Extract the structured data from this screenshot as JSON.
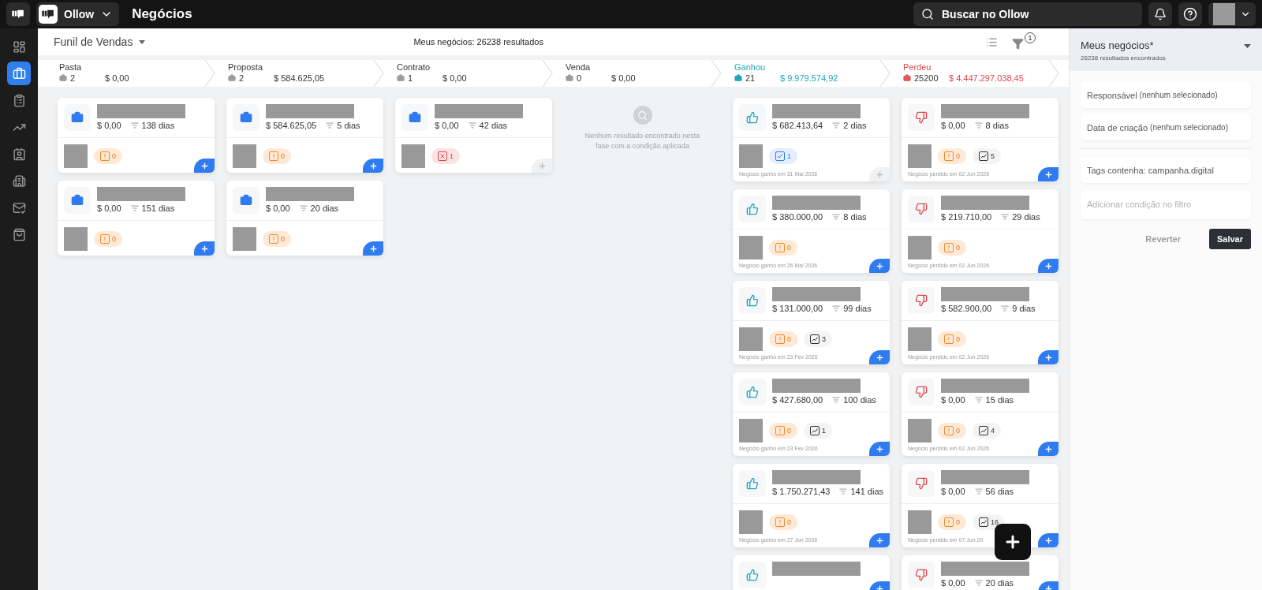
{
  "topbar": {
    "app_name": "Ollow",
    "page_title": "Negócios",
    "search": {
      "placeholder": "Buscar no Ollow"
    }
  },
  "sidebar": {
    "items": [
      {
        "selected": false
      },
      {
        "selected": true
      },
      {
        "selected": false
      },
      {
        "selected": false
      },
      {
        "selected": false
      },
      {
        "selected": false
      },
      {
        "selected": false
      },
      {
        "selected": false
      }
    ]
  },
  "toolbar": {
    "pipeline": "Funil de Vendas",
    "summary_label": "Meus negócios:",
    "summary_value": "26238 resultados",
    "filter_count": "1"
  },
  "stages": [
    {
      "name": "Pasta",
      "kind": "open",
      "count": "2",
      "total": "$ 0,00",
      "cards": [
        {
          "amount": "$ 0,00",
          "days": "138 dias",
          "badges": [
            {
              "kind": "alert",
              "count": "0"
            }
          ],
          "add_enabled": true
        },
        {
          "amount": "$ 0,00",
          "days": "151 dias",
          "badges": [
            {
              "kind": "alert",
              "count": "0"
            }
          ],
          "add_enabled": true
        }
      ]
    },
    {
      "name": "Proposta",
      "kind": "open",
      "count": "2",
      "total": "$ 584.625,05",
      "cards": [
        {
          "amount": "$ 584.625,05",
          "days": "5 dias",
          "badges": [
            {
              "kind": "alert",
              "count": "0"
            }
          ],
          "add_enabled": true
        },
        {
          "amount": "$ 0,00",
          "days": "20 dias",
          "badges": [
            {
              "kind": "alert",
              "count": "0"
            }
          ],
          "add_enabled": true
        }
      ]
    },
    {
      "name": "Contrato",
      "kind": "open",
      "count": "1",
      "total": "$ 0,00",
      "cards": [
        {
          "amount": "$ 0,00",
          "days": "42 dias",
          "badges": [
            {
              "kind": "overdue",
              "count": "1"
            }
          ],
          "add_enabled": false
        }
      ]
    },
    {
      "name": "Venda",
      "kind": "open",
      "count": "0",
      "total": "$ 0,00",
      "empty_message": "Nenhum resultado encontrado nesta fase com a condição aplicada"
    },
    {
      "name": "Ganhou",
      "kind": "won",
      "count": "21",
      "total": "$ 9.979.574,92",
      "cards": [
        {
          "amount": "$ 682.413,64",
          "days": "2 dias",
          "badges": [
            {
              "kind": "done",
              "count": "1"
            }
          ],
          "footer": "Negócio ganho em 31 Mai 2026",
          "add_enabled": false
        },
        {
          "amount": "$ 380.000,00",
          "days": "8 dias",
          "badges": [
            {
              "kind": "alert",
              "count": "0"
            }
          ],
          "footer": "Negócio ganho em 26 Mai 2026",
          "add_enabled": true
        },
        {
          "amount": "$ 131.000,00",
          "days": "99 dias",
          "badges": [
            {
              "kind": "alert",
              "count": "0"
            },
            {
              "kind": "chart",
              "count": "3"
            }
          ],
          "footer": "Negócio ganho em 23 Fev 2026",
          "add_enabled": true
        },
        {
          "amount": "$ 427.680,00",
          "days": "100 dias",
          "badges": [
            {
              "kind": "alert",
              "count": "0"
            },
            {
              "kind": "chart",
              "count": "1"
            }
          ],
          "footer": "Negócio ganho em 23 Fev 2026",
          "add_enabled": true
        },
        {
          "amount": "$ 1.750.271,43",
          "days": "141 dias",
          "badges": [
            {
              "kind": "alert",
              "count": "0"
            }
          ],
          "footer": "Negócio ganho em 27 Jun 2026",
          "add_enabled": true
        },
        {
          "add_enabled": true
        }
      ]
    },
    {
      "name": "Perdeu",
      "kind": "lost",
      "count": "25200",
      "total": "$ 4.447.297.038,45",
      "cards": [
        {
          "amount": "$ 0,00",
          "days": "8 dias",
          "badges": [
            {
              "kind": "alert",
              "count": "0"
            },
            {
              "kind": "chart",
              "count": "5"
            }
          ],
          "footer": "Negócio perdido em 02 Jun 2026",
          "add_enabled": true
        },
        {
          "amount": "$ 219.710,00",
          "days": "29 dias",
          "badges": [
            {
              "kind": "alert",
              "count": "0"
            }
          ],
          "footer": "Negócio perdido em 02 Jun 2026",
          "add_enabled": true
        },
        {
          "amount": "$ 582.900,00",
          "days": "9 dias",
          "badges": [
            {
              "kind": "alert",
              "count": "0"
            }
          ],
          "footer": "Negócio perdido em 02 Jun 2026",
          "add_enabled": true
        },
        {
          "amount": "$ 0,00",
          "days": "15 dias",
          "badges": [
            {
              "kind": "alert",
              "count": "0"
            },
            {
              "kind": "chart",
              "count": "4"
            }
          ],
          "footer": "Negócio perdido em 02 Jun 2026",
          "add_enabled": true
        },
        {
          "amount": "$ 0,00",
          "days": "56 dias",
          "badges": [
            {
              "kind": "alert",
              "count": "0"
            },
            {
              "kind": "chart",
              "count": "16"
            }
          ],
          "footer": "Negócio perdido em 07 Jun 20",
          "add_enabled": true
        },
        {
          "amount": "$ 0,00",
          "days": "20 dias",
          "add_enabled": true
        }
      ]
    }
  ],
  "filter_panel": {
    "title": "Meus negócios*",
    "subtitle": "26238 resultados encontrados",
    "conditions": [
      {
        "label": "Responsável",
        "note": "(nenhum selecionado)"
      },
      {
        "label": "Data de criação",
        "note": "(nenhum selecionado)"
      }
    ],
    "tags": "Tags contenha: campanha.digital",
    "add_placeholder": "Adicionar condição no filtro",
    "buttons": [
      {
        "label": "Reverter",
        "disabled": true
      },
      {
        "label": "Salvar",
        "disabled": false
      }
    ]
  }
}
